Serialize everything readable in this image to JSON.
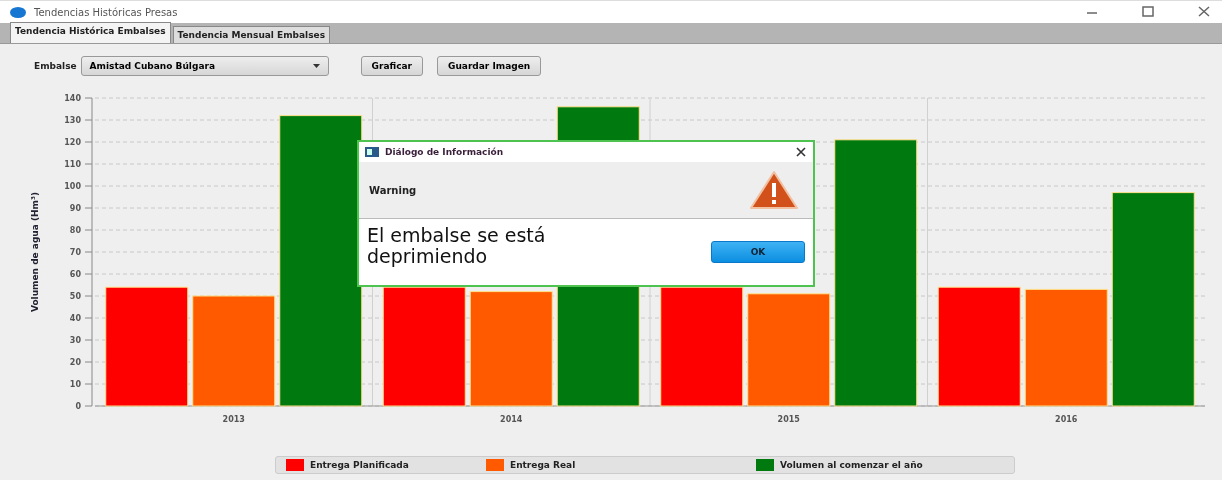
{
  "window": {
    "title": "Tendencias Históricas Presas"
  },
  "tabs": [
    {
      "label": "Tendencia Histórica Embalses",
      "selected": true
    },
    {
      "label": "Tendencia Mensual Embalses",
      "selected": false
    }
  ],
  "toolbar": {
    "embalse_label": "Embalse",
    "embalse_value": "Amistad Cubano Búlgara",
    "buttons": [
      "Graficar",
      "Guardar Imagen"
    ]
  },
  "chart_data": {
    "type": "bar",
    "ylabel": "Volumen de agua (Hm³)",
    "categories": [
      "2013",
      "2014",
      "2015",
      "2016"
    ],
    "series": [
      {
        "name": "Entrega Planificada",
        "color": "#ff0000",
        "values": [
          54,
          54,
          54,
          54
        ]
      },
      {
        "name": "Entrega Real",
        "color": "#ff5a00",
        "values": [
          50,
          52,
          51,
          53
        ]
      },
      {
        "name": "Volumen al comenzar el año",
        "color": "#007a0f",
        "values": [
          132,
          136,
          121,
          97
        ]
      }
    ],
    "grid": true,
    "ylim": [
      0,
      140
    ],
    "yticks": [
      0,
      10,
      20,
      30,
      40,
      50,
      60,
      70,
      80,
      90,
      100,
      110,
      120,
      130,
      140
    ]
  },
  "dialog": {
    "title": "Diálogo de Información",
    "header": "Warning",
    "message": "El embalse se está deprimiendo",
    "button": "OK"
  }
}
